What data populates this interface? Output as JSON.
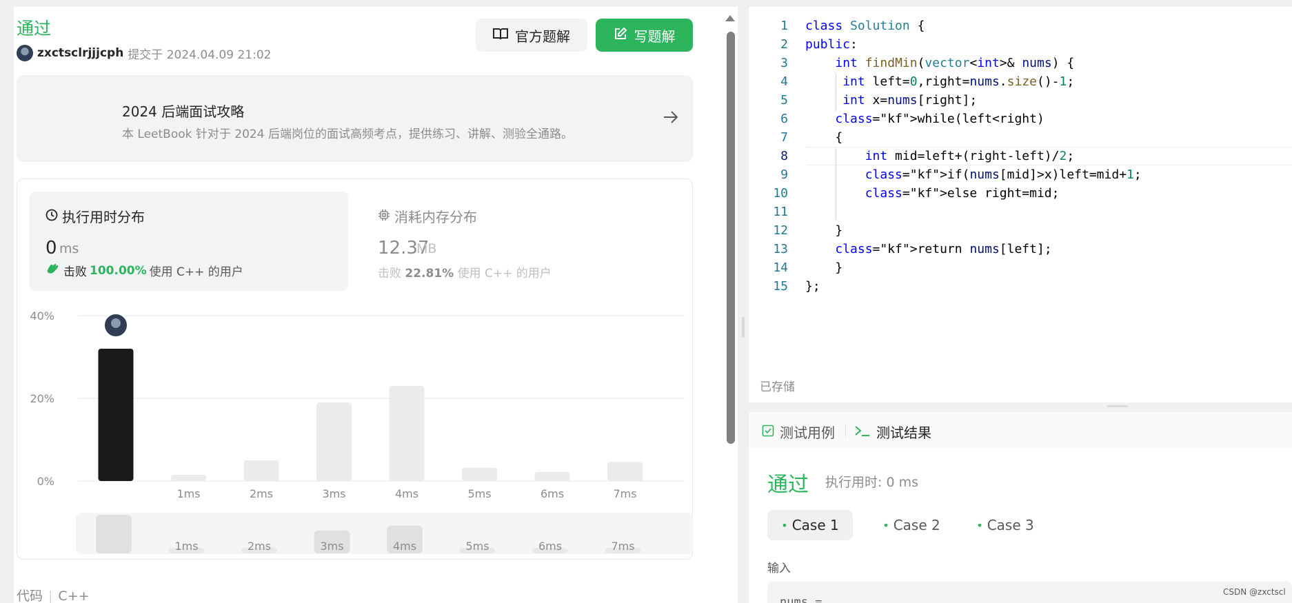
{
  "submission": {
    "status": "通过",
    "username": "zxctsclrjjjcph",
    "submitted_text": "提交于 2024.04.09 21:02",
    "official_solution_label": "官方题解",
    "write_solution_label": "写题解"
  },
  "leetbook": {
    "title": "2024 后端面试攻略",
    "description": "本 LeetBook 针对于 2024 后端岗位的面试高频考点，提供练习、讲解、测验全通路。"
  },
  "stats": {
    "runtime": {
      "title": "执行用时分布",
      "value": "0",
      "unit": "ms",
      "beat_prefix": "击败",
      "beat_pct": "100.00%",
      "beat_suffix": "使用 C++ 的用户"
    },
    "memory": {
      "title": "消耗内存分布",
      "value": "12.37",
      "unit": "MB",
      "beat_prefix": "击败",
      "beat_pct": "22.81%",
      "beat_suffix": "使用 C++ 的用户"
    }
  },
  "chart_data": {
    "type": "bar",
    "categories": [
      "",
      "1ms",
      "2ms",
      "3ms",
      "4ms",
      "5ms",
      "6ms",
      "7ms"
    ],
    "values": [
      32,
      1.5,
      5,
      19,
      23,
      3.2,
      2.2,
      4.6
    ],
    "highlight_index": 0,
    "y_ticks": [
      "0%",
      "20%",
      "40%"
    ],
    "ylim": [
      0,
      40
    ],
    "grid": true,
    "highlight_color": "#1a1a1a",
    "bar_color": "#ebebeb"
  },
  "code_section": {
    "label": "代码",
    "language": "C++"
  },
  "editor": {
    "lines": [
      "class Solution {",
      "public:",
      "    int findMin(vector<int>& nums) {",
      "     int left=0,right=nums.size()-1;",
      "     int x=nums[right];",
      "    while(left<right)",
      "    {",
      "        int mid=left+(right-left)/2;",
      "        if(nums[mid]>x)left=mid+1;",
      "        else right=mid;",
      "",
      "    }",
      "    return nums[left];",
      "    }",
      "};"
    ],
    "active_line": 8,
    "saved_label": "已存储"
  },
  "test_panel": {
    "tab_cases": "测试用例",
    "tab_result": "测试结果",
    "result_status": "通过",
    "result_time": "执行用时: 0 ms",
    "cases": [
      "Case 1",
      "Case 2",
      "Case 3"
    ],
    "input_label": "输入",
    "input_preview": "nums ="
  },
  "watermark": "CSDN @zxctscl",
  "colors": {
    "accent": "#2db55d",
    "text": "#262626",
    "muted": "#8c8c8c"
  }
}
